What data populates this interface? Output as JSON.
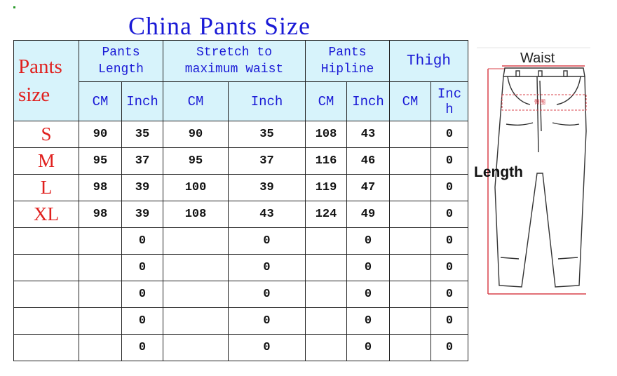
{
  "title": "China Pants Size",
  "table": {
    "size_header": [
      "Pants",
      "size"
    ],
    "groups": [
      {
        "label_lines": [
          "Pants",
          "Length"
        ]
      },
      {
        "label_lines": [
          "Stretch to",
          "maximum waist"
        ]
      },
      {
        "label_lines": [
          "Pants",
          "Hipline"
        ]
      },
      {
        "label_lines": [
          "Thigh"
        ]
      }
    ],
    "units": [
      "CM",
      "Inch",
      "CM",
      "Inch",
      "CM",
      "Inch",
      "CM",
      "Inc\nh"
    ],
    "rows": [
      {
        "size": "S",
        "values": [
          "90",
          "35",
          "90",
          "35",
          "108",
          "43",
          "",
          "0"
        ]
      },
      {
        "size": "M",
        "values": [
          "95",
          "37",
          "95",
          "37",
          "116",
          "46",
          "",
          "0"
        ]
      },
      {
        "size": "L",
        "values": [
          "98",
          "39",
          "100",
          "39",
          "119",
          "47",
          "",
          "0"
        ]
      },
      {
        "size": "XL",
        "values": [
          "98",
          "39",
          "108",
          "43",
          "124",
          "49",
          "",
          "0"
        ]
      },
      {
        "size": "",
        "values": [
          "",
          "0",
          "",
          "0",
          "",
          "0",
          "",
          "0"
        ]
      },
      {
        "size": "",
        "values": [
          "",
          "0",
          "",
          "0",
          "",
          "0",
          "",
          "0"
        ]
      },
      {
        "size": "",
        "values": [
          "",
          "0",
          "",
          "0",
          "",
          "0",
          "",
          "0"
        ]
      },
      {
        "size": "",
        "values": [
          "",
          "0",
          "",
          "0",
          "",
          "0",
          "",
          "0"
        ]
      },
      {
        "size": "",
        "values": [
          "",
          "0",
          "",
          "0",
          "",
          "0",
          "",
          "0"
        ]
      }
    ]
  },
  "diagram": {
    "waist_label": "Waist",
    "length_label": "Length",
    "hip_label": "臀围",
    "colors": {
      "measure": "#d8404a",
      "outline": "#333333"
    }
  }
}
